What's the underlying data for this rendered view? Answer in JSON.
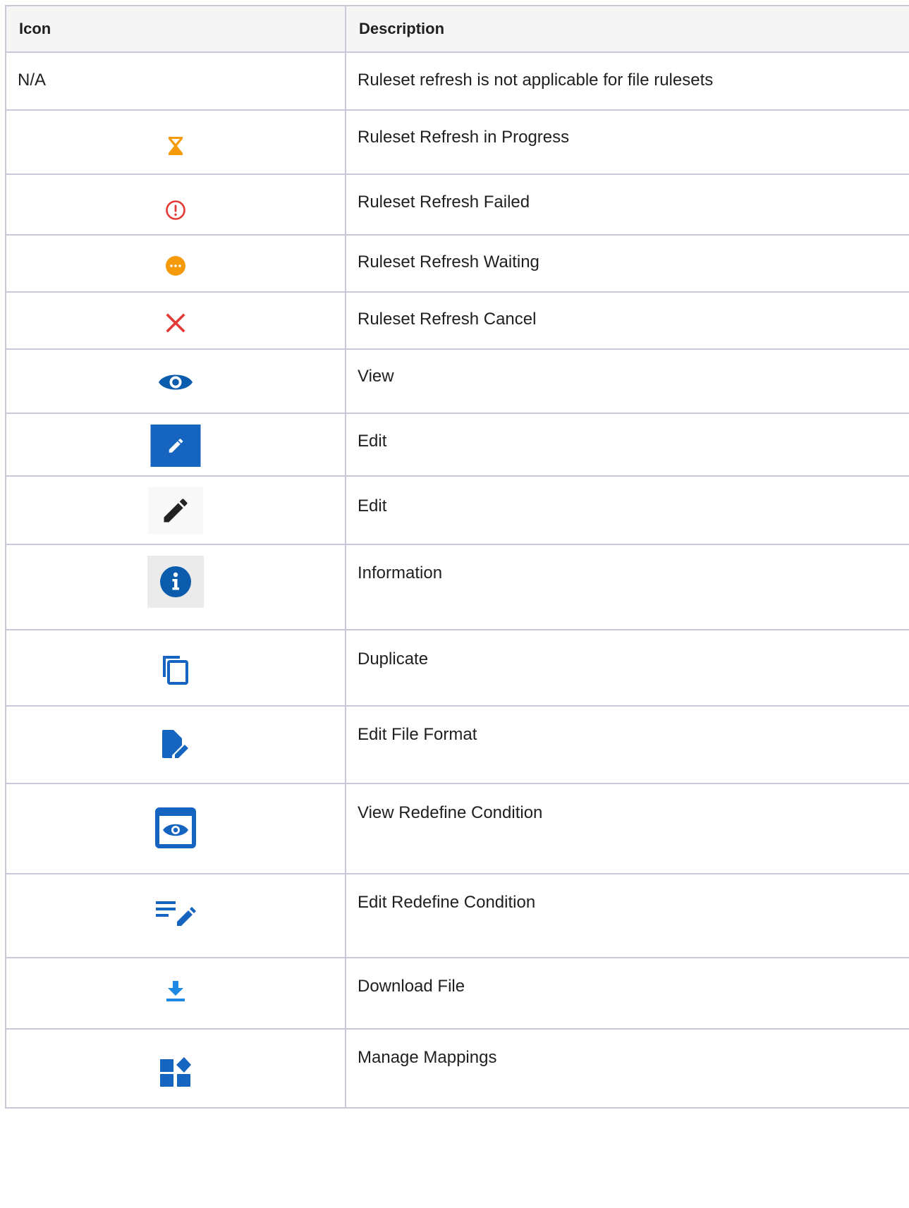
{
  "table": {
    "headers": {
      "icon": "Icon",
      "description": "Description"
    },
    "rows": [
      {
        "icon_text": "N/A",
        "icon": "none",
        "description": "Ruleset refresh is not applicable for file rulesets"
      },
      {
        "icon": "hourglass-icon",
        "color": "#f59b0b",
        "description": "Ruleset Refresh in Progress"
      },
      {
        "icon": "error-circle-icon",
        "color": "#e53935",
        "description": "Ruleset Refresh Failed"
      },
      {
        "icon": "waiting-dots-icon",
        "color": "#f59b0b",
        "description": "Ruleset Refresh Waiting"
      },
      {
        "icon": "close-x-icon",
        "color": "#e53935",
        "description": "Ruleset Refresh Cancel"
      },
      {
        "icon": "eye-icon",
        "color": "#0b5cad",
        "description": "View"
      },
      {
        "icon": "pencil-blue-box-icon",
        "color": "#1565c0",
        "description": "Edit"
      },
      {
        "icon": "pencil-black-icon",
        "color": "#222222",
        "description": "Edit"
      },
      {
        "icon": "info-icon",
        "color": "#0b5cad",
        "description": "Information"
      },
      {
        "icon": "duplicate-icon",
        "color": "#1565c0",
        "description": "Duplicate"
      },
      {
        "icon": "edit-file-icon",
        "color": "#1565c0",
        "description": "Edit File Format"
      },
      {
        "icon": "view-box-icon",
        "color": "#1565c0",
        "description": "View Redefine Condition"
      },
      {
        "icon": "edit-list-icon",
        "color": "#1565c0",
        "description": "Edit Redefine Condition"
      },
      {
        "icon": "download-icon",
        "color": "#1e88e5",
        "description": "Download File"
      },
      {
        "icon": "manage-mappings-icon",
        "color": "#1565c0",
        "description": "Manage Mappings"
      }
    ]
  }
}
